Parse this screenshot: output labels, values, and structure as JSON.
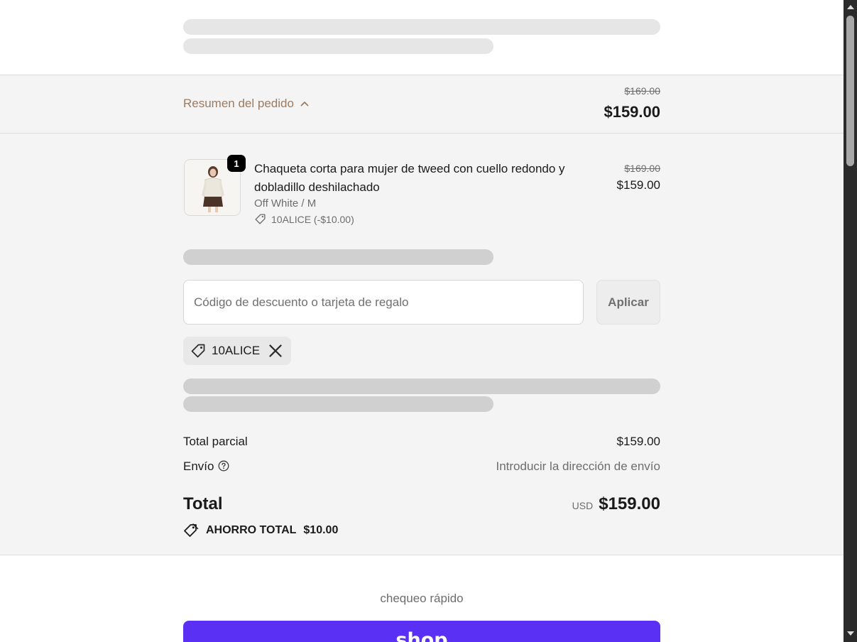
{
  "order_summary": {
    "toggle_label": "Resumen del pedido",
    "original_price": "$169.00",
    "current_price": "$159.00"
  },
  "line_item": {
    "quantity": "1",
    "title": "Chaqueta corta para mujer de tweed con cuello redondo y dobladillo deshilachado",
    "variant": "Off White / M",
    "discount": "10ALICE (-$10.00)",
    "original_price": "$169.00",
    "price": "$159.00"
  },
  "discount_form": {
    "placeholder": "Código de descuento o tarjeta de regalo",
    "value": "",
    "apply_label": "Aplicar"
  },
  "applied_code": {
    "code": "10ALICE"
  },
  "totals": {
    "subtotal_label": "Total parcial",
    "subtotal_value": "$159.00",
    "shipping_label": "Envío",
    "shipping_value": "Introducir la dirección de envío",
    "total_label": "Total",
    "currency": "USD",
    "total_value": "$159.00",
    "savings_label": "AHORRO TOTAL",
    "savings_value": "$10.00"
  },
  "express_checkout": {
    "label": "chequeo rápido",
    "shop_button_label": "shop"
  },
  "icons": {
    "chevron": "chevron-up-icon",
    "tag": "discount-tag-icon",
    "close": "close-icon",
    "help": "help-circle-icon",
    "savings": "savings-tag-icon"
  },
  "colors": {
    "accent_link": "#9a7b63",
    "panel_bg": "#f4f4f4",
    "shop_pay": "#5a31f4",
    "badge": "#000000"
  }
}
